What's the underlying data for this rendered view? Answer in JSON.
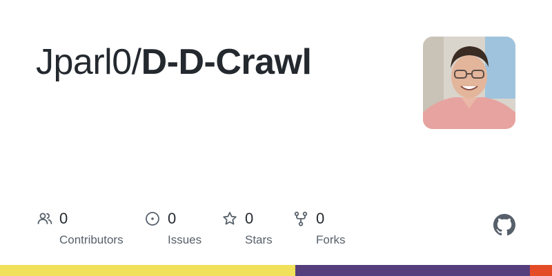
{
  "repo": {
    "owner": "Jparl0",
    "separator": "/",
    "name": "D-D-Crawl"
  },
  "avatar": {
    "alt": "owner avatar"
  },
  "stats": {
    "contributors": {
      "count": "0",
      "label": "Contributors",
      "icon": "people-icon"
    },
    "issues": {
      "count": "0",
      "label": "Issues",
      "icon": "issue-opened-icon"
    },
    "stars": {
      "count": "0",
      "label": "Stars",
      "icon": "star-icon"
    },
    "forks": {
      "count": "0",
      "label": "Forks",
      "icon": "repo-forked-icon"
    }
  },
  "brand": {
    "icon": "github-mark-icon"
  },
  "colors": {
    "text": "#24292f",
    "muted": "#57606a",
    "icon": "#57606a",
    "language_bar": [
      "#f1e05a",
      "#563d7c",
      "#e34c26"
    ]
  },
  "language_bar": {
    "segments": [
      {
        "color": "#f1e05a",
        "fraction": 0.535
      },
      {
        "color": "#563d7c",
        "fraction": 0.425
      },
      {
        "color": "#e34c26",
        "fraction": 0.04
      }
    ]
  }
}
